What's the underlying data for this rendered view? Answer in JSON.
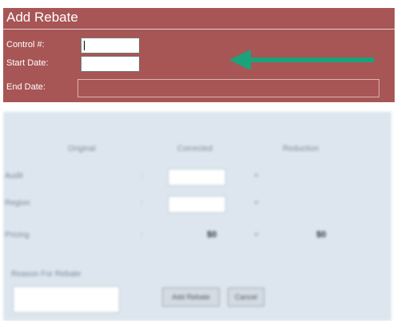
{
  "form": {
    "title": "Add Rebate",
    "control_label": "Control #:",
    "control_value": "",
    "start_label": "Start Date:",
    "start_value": "",
    "end_label": "End Date:",
    "end_value": ""
  },
  "colors": {
    "header_bg": "#a85555",
    "arrow": "#1aa37a",
    "panel_bg": "#dde6ee"
  },
  "panel": {
    "col_original": "Original",
    "col_corrected": "Corrected",
    "col_reduction": "Reduction",
    "row_audit": "Audit",
    "row_region": "Region",
    "row_pricing": "Pricing",
    "colon": ":",
    "equals": "=",
    "pricing_corrected": "$0",
    "pricing_reduction": "$0",
    "reason_label": "Reason For Rebate",
    "add_rebate_button": "Add Rebate",
    "cancel_button": "Cancel"
  }
}
